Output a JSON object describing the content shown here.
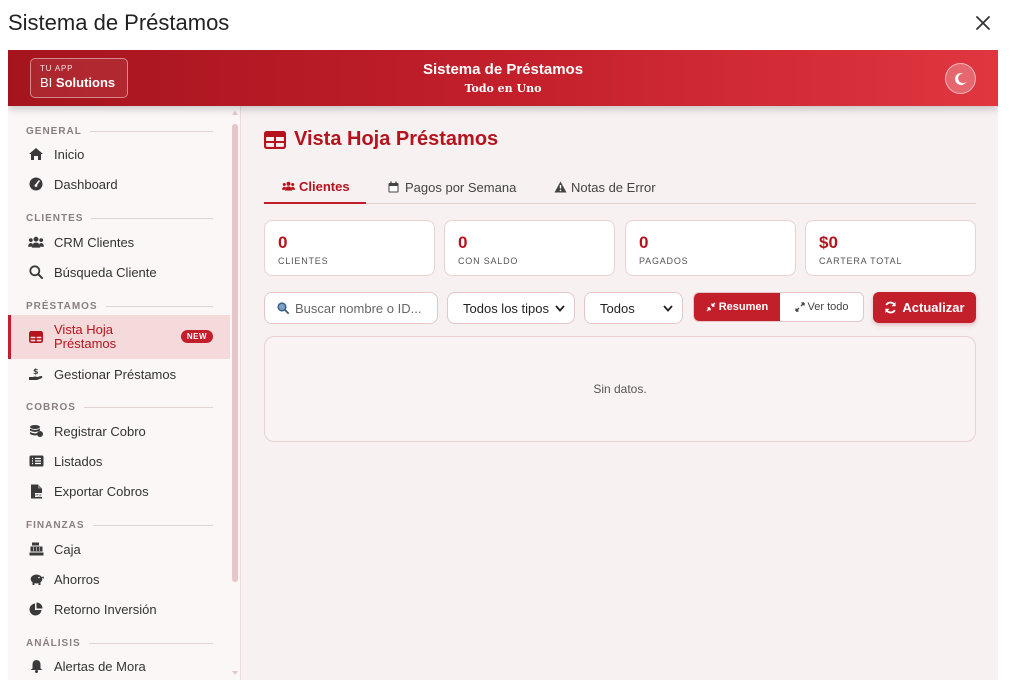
{
  "window": {
    "title": "Sistema de Préstamos"
  },
  "header": {
    "brand_small": "TU APP",
    "brand_prefix": "BI",
    "brand_name": "Solutions",
    "title": "Sistema de Préstamos",
    "subtitle": "Todo en Uno"
  },
  "sidebar": {
    "sections": {
      "general": "GENERAL",
      "clientes": "CLIENTES",
      "prestamos": "PRÉSTAMOS",
      "cobros": "COBROS",
      "finanzas": "FINANZAS",
      "analisis": "ANÁLISIS"
    },
    "items": {
      "inicio": "Inicio",
      "dashboard": "Dashboard",
      "crm": "CRM Clientes",
      "busqueda": "Búsqueda Cliente",
      "vista_hoja": "Vista Hoja Préstamos",
      "gestionar": "Gestionar Préstamos",
      "registrar": "Registrar Cobro",
      "listados": "Listados",
      "exportar": "Exportar Cobros",
      "caja": "Caja",
      "ahorros": "Ahorros",
      "retorno": "Retorno Inversión",
      "alertas": "Alertas de Mora"
    },
    "badge_new": "NEW"
  },
  "main": {
    "title": "Vista Hoja Préstamos",
    "tabs": {
      "clientes": "Clientes",
      "pagos": "Pagos por Semana",
      "notas": "Notas de Error"
    },
    "cards": {
      "clientes": {
        "value": "0",
        "label": "CLIENTES"
      },
      "con_saldo": {
        "value": "0",
        "label": "CON SALDO"
      },
      "pagados": {
        "value": "0",
        "label": "PAGADOS"
      },
      "cartera": {
        "value": "$0",
        "label": "CARTERA TOTAL"
      }
    },
    "search_placeholder": "Buscar nombre o ID...",
    "type_filter": "Todos los tipos",
    "status_filter": "Todos",
    "view_summary": "Resumen",
    "view_all": "Ver todo",
    "refresh": "Actualizar",
    "empty": "Sin datos."
  },
  "colors": {
    "accent": "#c21f2b",
    "accent_dark": "#a5141d"
  }
}
